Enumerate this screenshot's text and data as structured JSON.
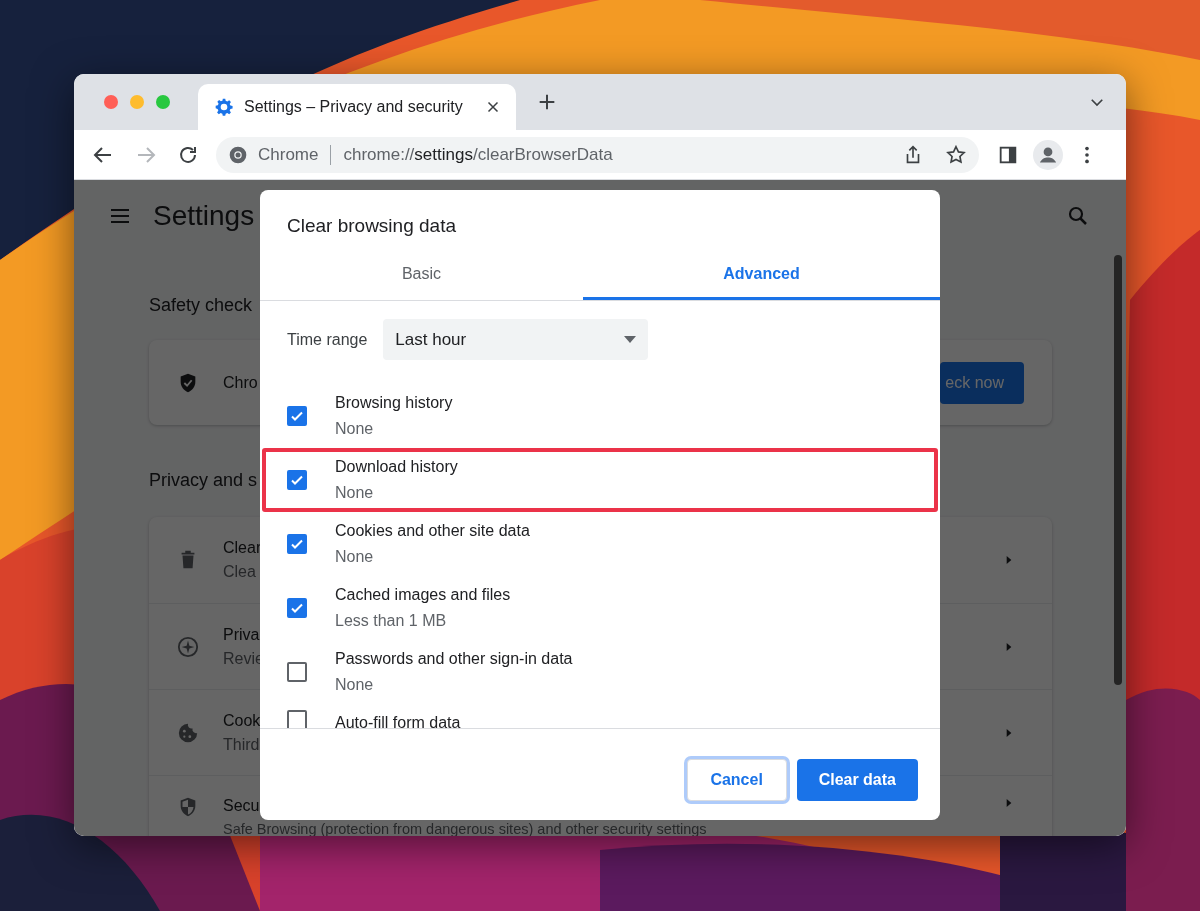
{
  "browser": {
    "tab": {
      "title": "Settings – Privacy and security"
    },
    "toolbar": {
      "forward": {
        "disabled": true
      },
      "omnibox": {
        "site": "Chrome",
        "url": "chrome://**settings**/clearBrowserData"
      }
    }
  },
  "settings": {
    "title": "Settings",
    "safety_check": {
      "heading": "Safety check",
      "text": "Chro",
      "button": "eck now"
    },
    "privacy": {
      "heading": "Privacy and s",
      "rows": [
        {
          "kind": "trash",
          "title": "Clear",
          "subtitle": "Clea"
        },
        {
          "kind": "compass",
          "title": "Priva",
          "subtitle": "Revie"
        },
        {
          "kind": "cookie",
          "title": "Cook",
          "subtitle": "Third"
        },
        {
          "kind": "shield",
          "title": "Secu",
          "subtitle": "Safe Browsing (protection from dangerous sites) and other security settings"
        }
      ]
    }
  },
  "dialog": {
    "title": "Clear browsing data",
    "tabs": [
      {
        "label": "Basic",
        "selected": false
      },
      {
        "label": "Advanced",
        "selected": true
      }
    ],
    "time_range": {
      "label": "Time range",
      "value": "Last hour"
    },
    "items": [
      {
        "label": "Browsing history",
        "detail": "None",
        "checked": true,
        "highlighted": false
      },
      {
        "label": "Download history",
        "detail": "None",
        "checked": true,
        "highlighted": true
      },
      {
        "label": "Cookies and other site data",
        "detail": "None",
        "checked": true,
        "highlighted": false
      },
      {
        "label": "Cached images and files",
        "detail": "Less than 1 MB",
        "checked": true,
        "highlighted": false
      },
      {
        "label": "Passwords and other sign-in data",
        "detail": "None",
        "checked": false,
        "highlighted": false
      },
      {
        "label": "Auto-fill form data",
        "checked": false,
        "highlighted": false
      }
    ],
    "buttons": [
      {
        "label": "Cancel",
        "kind": "secondary",
        "focused": true
      },
      {
        "label": "Clear data",
        "kind": "primary",
        "focused": false
      }
    ]
  }
}
